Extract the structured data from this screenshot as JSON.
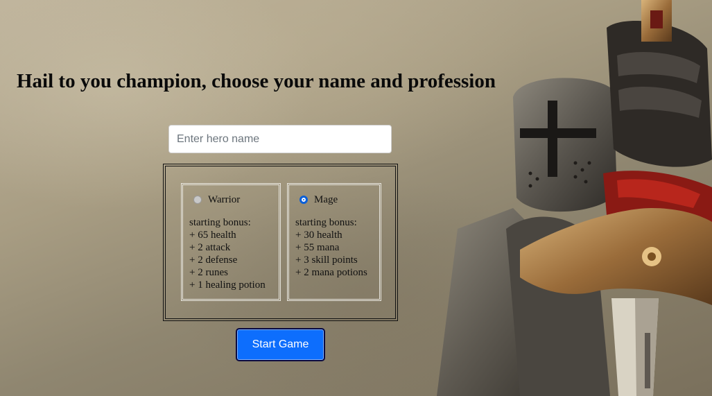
{
  "header": {
    "title": "Hail to you champion, choose your name and profession"
  },
  "hero_name": {
    "placeholder": "Enter hero name",
    "value": ""
  },
  "professions": [
    {
      "name": "Warrior",
      "selected": false,
      "bonus_title": "starting bonus:",
      "bonuses": [
        "+ 65 health",
        "+ 2 attack",
        "+ 2 defense",
        "+ 2 runes",
        "+ 1 healing potion"
      ]
    },
    {
      "name": "Mage",
      "selected": true,
      "bonus_title": "starting bonus:",
      "bonuses": [
        "+ 30 health",
        "+ 55 mana",
        "+ 3 skill points",
        "+ 2 mana potions"
      ]
    }
  ],
  "actions": {
    "start_label": "Start Game"
  },
  "colors": {
    "primary_button": "#0d6efd",
    "radio_selected": "#0a5fd8"
  }
}
